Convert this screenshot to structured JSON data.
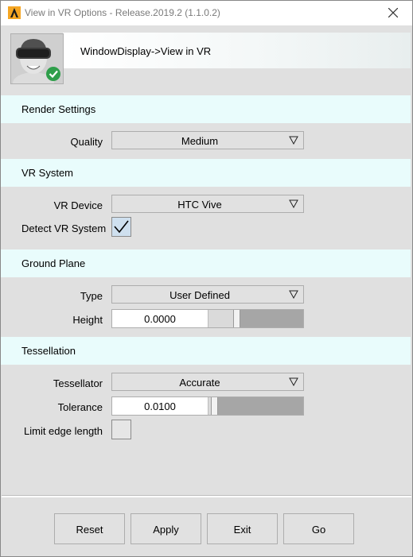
{
  "window": {
    "title": "View in VR Options - Release.2019.2 (1.1.0.2)"
  },
  "header": {
    "path": "WindowDisplay->View in VR"
  },
  "sections": {
    "render": {
      "title": "Render Settings",
      "quality_label": "Quality",
      "quality_value": "Medium"
    },
    "vr_system": {
      "title": "VR System",
      "device_label": "VR Device",
      "device_value": "HTC Vive",
      "detect_label": "Detect VR System",
      "detect_checked": true
    },
    "ground": {
      "title": "Ground Plane",
      "type_label": "Type",
      "type_value": "User Defined",
      "height_label": "Height",
      "height_value": "0.0000",
      "height_slider_fraction": 0.28
    },
    "tessellation": {
      "title": "Tessellation",
      "tessellator_label": "Tessellator",
      "tessellator_value": "Accurate",
      "tolerance_label": "Tolerance",
      "tolerance_value": "0.0100",
      "tolerance_slider_fraction": 0.03,
      "limit_label": "Limit edge length",
      "limit_checked": false
    }
  },
  "buttons": {
    "reset": "Reset",
    "apply": "Apply",
    "exit": "Exit",
    "go": "Go"
  },
  "colors": {
    "section_bg": "#e9fcfc",
    "window_bg": "#e0e0e0",
    "app_icon": "#f5a623",
    "badge": "#2e9e4a"
  }
}
